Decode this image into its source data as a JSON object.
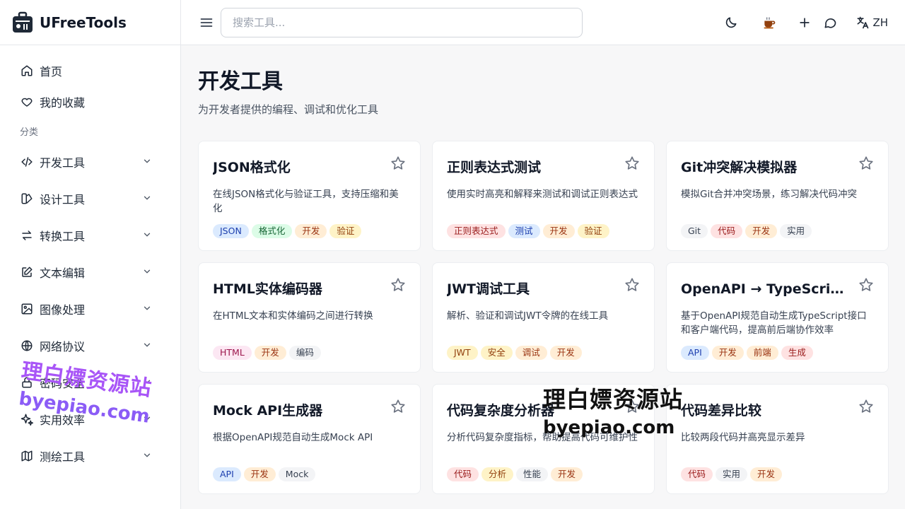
{
  "brand": {
    "name": "UFreeTools"
  },
  "nav": [
    {
      "label": "首页",
      "icon": "home-icon"
    },
    {
      "label": "我的收藏",
      "icon": "heart-icon"
    }
  ],
  "section_label": "分类",
  "categories": [
    {
      "label": "开发工具",
      "icon": "code-icon"
    },
    {
      "label": "设计工具",
      "icon": "palette-icon"
    },
    {
      "label": "转换工具",
      "icon": "arrows-swap-icon"
    },
    {
      "label": "文本编辑",
      "icon": "edit-icon"
    },
    {
      "label": "图像处理",
      "icon": "image-icon"
    },
    {
      "label": "网络协议",
      "icon": "globe-icon"
    },
    {
      "label": "密码安全",
      "icon": "lock-icon"
    },
    {
      "label": "实用效率",
      "icon": "sparkles-icon"
    },
    {
      "label": "测绘工具",
      "icon": "map-icon"
    }
  ],
  "search": {
    "placeholder": "搜索工具..."
  },
  "topbar": {
    "lang": "ZH"
  },
  "page": {
    "title": "开发工具",
    "subtitle": "为开发者提供的编程、调试和优化工具"
  },
  "cards": [
    {
      "title": "JSON格式化",
      "desc": "在线JSON格式化与验证工具，支持压缩和美化",
      "tags": [
        "JSON",
        "格式化",
        "开发",
        "验证"
      ]
    },
    {
      "title": "正则表达式测试",
      "desc": "使用实时高亮和解释来测试和调试正则表达式",
      "tags": [
        "正则表达式",
        "测试",
        "开发",
        "验证"
      ]
    },
    {
      "title": "Git冲突解决模拟器",
      "desc": "模拟Git合并冲突场景，练习解决代码冲突",
      "tags": [
        "Git",
        "代码",
        "开发",
        "实用"
      ]
    },
    {
      "title": "HTML实体编码器",
      "desc": "在HTML文本和实体编码之间进行转换",
      "tags": [
        "HTML",
        "开发",
        "编码"
      ]
    },
    {
      "title": "JWT调试工具",
      "desc": "解析、验证和调试JWT令牌的在线工具",
      "tags": [
        "JWT",
        "安全",
        "调试",
        "开发"
      ]
    },
    {
      "title": "OpenAPI → TypeScript客户端生成器",
      "desc": "基于OpenAPI规范自动生成TypeScript接口和客户端代码，提高前后端协作效率",
      "tags": [
        "API",
        "开发",
        "前端",
        "生成"
      ]
    },
    {
      "title": "Mock API生成器",
      "desc": "根据OpenAPI规范自动生成Mock API",
      "tags": [
        "API",
        "开发",
        "Mock"
      ]
    },
    {
      "title": "代码复杂度分析器",
      "desc": "分析代码复杂度指标，帮助提高代码可维护性",
      "tags": [
        "代码",
        "分析",
        "性能",
        "开发"
      ]
    },
    {
      "title": "代码差异比较",
      "desc": "比较两段代码并高亮显示差异",
      "tags": [
        "代码",
        "实用",
        "开发"
      ]
    }
  ],
  "tag_colors": {
    "JSON": "t-blue",
    "格式化": "t-green",
    "开发": "t-orange",
    "验证": "t-yellow",
    "正则表达式": "t-red",
    "测试": "t-blue",
    "Git": "t-gray",
    "代码": "t-red",
    "实用": "t-gray",
    "HTML": "t-pink",
    "编码": "t-gray",
    "JWT": "t-yellow",
    "安全": "t-yellow",
    "调试": "t-orange",
    "API": "t-blue",
    "前端": "t-orange",
    "生成": "t-red",
    "Mock": "t-gray",
    "分析": "t-yellow",
    "性能": "t-gray"
  },
  "watermark": {
    "cn": "理白嫖资源站",
    "en": "byepiao.com"
  }
}
